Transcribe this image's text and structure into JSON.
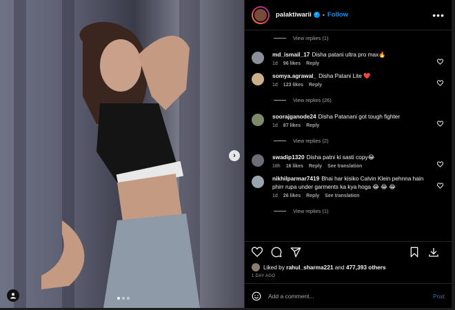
{
  "post": {
    "username": "palaktiwarii",
    "follow_label": "Follow",
    "separator": "•",
    "more_label": "•••"
  },
  "comments": [
    {
      "type": "replies",
      "label": "View replies (1)"
    },
    {
      "type": "comment",
      "user": "md_ismail_17",
      "text": "Disha patani ultra pro max🔥",
      "age": "1d",
      "likes": "96 likes",
      "reply": "Reply",
      "avatar_color": "#8a8f99"
    },
    {
      "type": "comment",
      "user": "somya.agrawal_",
      "text": "Disha Patani Lite ❤️",
      "age": "1d",
      "likes": "123 likes",
      "reply": "Reply",
      "avatar_color": "#c9b08a"
    },
    {
      "type": "replies",
      "label": "View replies (26)"
    },
    {
      "type": "comment",
      "user": "soorajganode24",
      "text": "Disha Patanani got tough fighter",
      "age": "1d",
      "likes": "87 likes",
      "reply": "Reply",
      "avatar_color": "#7d8a6b"
    },
    {
      "type": "replies",
      "label": "View replies (2)"
    },
    {
      "type": "comment",
      "user": "swadip1320",
      "text": "Disha patni ki sasti copy😂",
      "age": "18h",
      "likes": "16 likes",
      "reply": "Reply",
      "translate": "See translation",
      "avatar_color": "#6b6e78"
    },
    {
      "type": "comment",
      "user": "nikhilparmar7419",
      "text": "Bhai har kisiko Calvin Klein pehnna hain phirr rupa under garments ka kya hoga 😂 😂 😂",
      "age": "1d",
      "likes": "26 likes",
      "reply": "Reply",
      "translate": "See translation",
      "avatar_color": "#9aa3b0"
    },
    {
      "type": "replies",
      "label": "View replies (1)"
    }
  ],
  "likes": {
    "prefix": "Liked by",
    "user": "rahul_sharma221",
    "connector": "and",
    "others": "477,393 others"
  },
  "date": "1 DAY AGO",
  "add_comment": {
    "placeholder": "Add a comment...",
    "post_label": "Post"
  },
  "carousel": {
    "total": 3,
    "current": 1
  }
}
